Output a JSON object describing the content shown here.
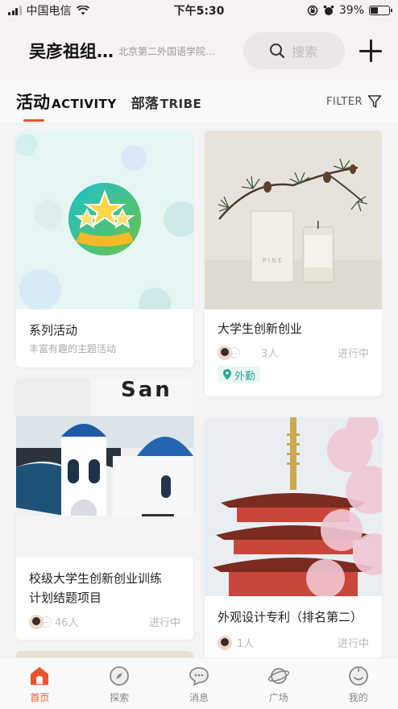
{
  "status_bar": {
    "carrier": "中国电信",
    "time": "下午5:30",
    "battery_percent": "39%",
    "battery_level": 0.39
  },
  "header": {
    "group_title": "吴彦祖组…",
    "school": "北京第二外国语学院…",
    "search_placeholder": "搜索"
  },
  "tabs": [
    {
      "cn": "活动",
      "en": "ACTIVITY",
      "active": true
    },
    {
      "cn": "部落",
      "en": "TRIBE",
      "active": false
    }
  ],
  "filter_label": "FILTER",
  "cards": [
    {
      "title": "系列活动",
      "subtitle": "丰富有趣的主题活动"
    },
    {
      "title": "大学生创新创业",
      "count": "3人",
      "status": "进行中",
      "tag": "外勤",
      "image_text": "PINE"
    },
    {
      "title_line1": "校级大学生创新创业训练",
      "title_line2": "计划结题项目",
      "count": "46人",
      "status": "进行中",
      "image_text": "San"
    },
    {
      "title": "外观设计专利（排名第二）",
      "count": "1人",
      "status": "进行中"
    }
  ],
  "tabbar": [
    {
      "label": "首页",
      "icon": "home-icon",
      "active": true
    },
    {
      "label": "探索",
      "icon": "compass-icon",
      "active": false
    },
    {
      "label": "消息",
      "icon": "message-icon",
      "active": false
    },
    {
      "label": "广场",
      "icon": "planet-icon",
      "active": false
    },
    {
      "label": "我的",
      "icon": "profile-icon",
      "active": false
    }
  ],
  "colors": {
    "accent": "#e8542e",
    "tag": "#2aa690"
  }
}
